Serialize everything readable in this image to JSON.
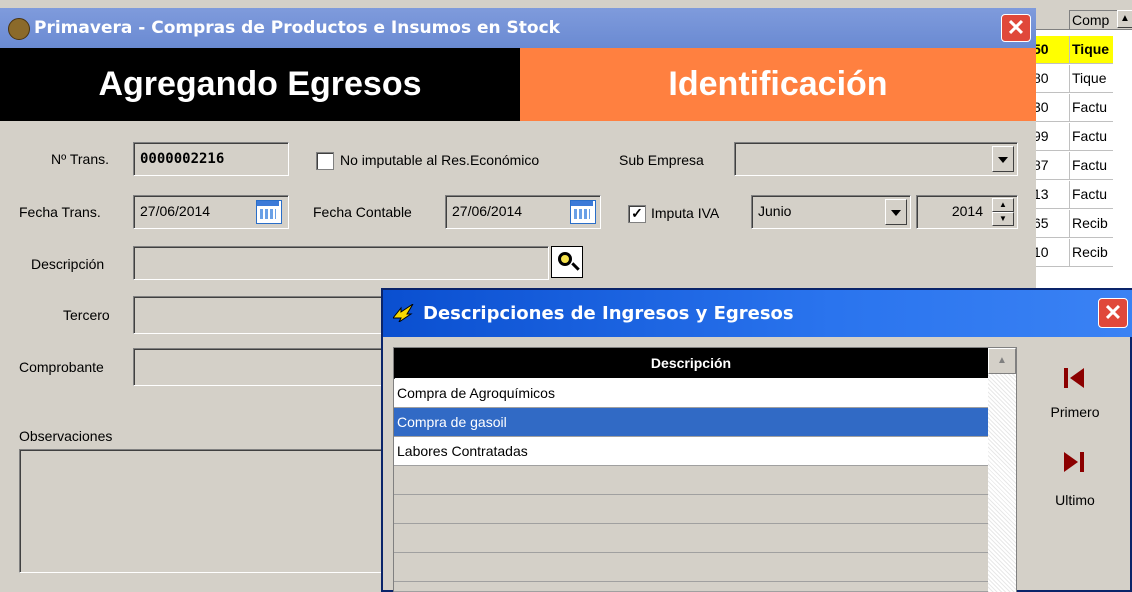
{
  "main_window": {
    "title": "Primavera - Compras de Productos e Insumos en Stock",
    "header_left": "Agregando Egresos",
    "header_right": "Identificación",
    "close_symbol": "✕"
  },
  "form": {
    "ntrans_label": "Nº Trans.",
    "ntrans_value": "0000002216",
    "no_imputable_label": "No imputable al Res.Económico",
    "no_imputable_checked": false,
    "sub_empresa_label": "Sub Empresa",
    "sub_empresa_value": "",
    "fecha_trans_label": "Fecha Trans.",
    "fecha_trans_value": "27/06/2014",
    "fecha_contable_label": "Fecha Contable",
    "fecha_contable_value": "27/06/2014",
    "imputa_iva_label": "Imputa IVA",
    "imputa_iva_checked": true,
    "mes_value": "Junio",
    "anio_value": "2014",
    "descripcion_label": "Descripción",
    "descripcion_value": "",
    "tercero_label": "Tercero",
    "comprobante_label": "Comprobante",
    "observaciones_label": "Observaciones"
  },
  "background_grid": {
    "header": "Comp",
    "rows": [
      {
        "c1": "50",
        "c2": "Tique",
        "selected": true
      },
      {
        "c1": "80",
        "c2": "Tique",
        "selected": false
      },
      {
        "c1": "30",
        "c2": "Factu",
        "selected": false
      },
      {
        "c1": "99",
        "c2": "Factu",
        "selected": false
      },
      {
        "c1": "87",
        "c2": "Factu",
        "selected": false
      },
      {
        "c1": "13",
        "c2": "Factu",
        "selected": false
      },
      {
        "c1": "65",
        "c2": "Recib",
        "selected": false
      },
      {
        "c1": "10",
        "c2": "Recib",
        "selected": false
      }
    ]
  },
  "dialog": {
    "title": "Descripciones de Ingresos y Egresos",
    "column_header": "Descripción",
    "items": [
      {
        "label": "Compra de Agroquímicos",
        "selected": false
      },
      {
        "label": "Compra de gasoil",
        "selected": true
      },
      {
        "label": "Labores Contratadas",
        "selected": false
      },
      {
        "label": "",
        "selected": false
      },
      {
        "label": "",
        "selected": false
      },
      {
        "label": "",
        "selected": false
      },
      {
        "label": "",
        "selected": false
      },
      {
        "label": "",
        "selected": false
      }
    ],
    "primero_label": "Primero",
    "ultimo_label": "Ultimo"
  },
  "colors": {
    "header_left_bg": "#000000",
    "header_right_bg": "#ff8040",
    "selection": "#316ac5",
    "grid_highlight": "#ffff00",
    "nav_icon": "#8b0000"
  }
}
